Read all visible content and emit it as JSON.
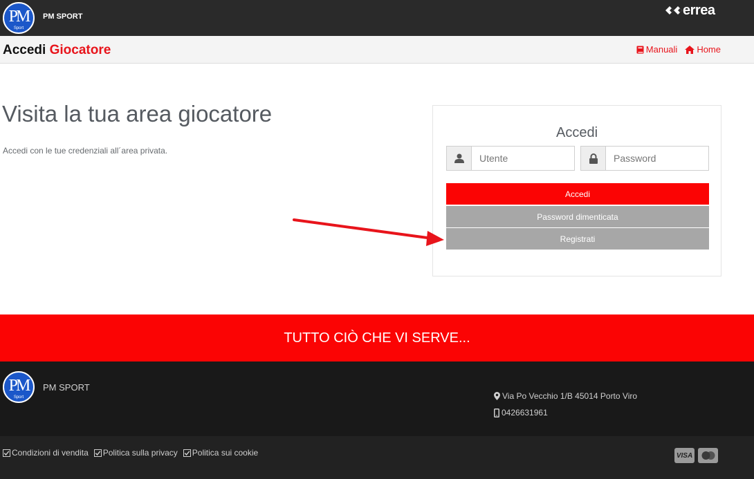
{
  "header": {
    "brand_name": "PM SPORT",
    "logo_monogram": "PM",
    "logo_subtext": "Sport",
    "partner_logo": "errea"
  },
  "subheader": {
    "title_prefix": "Accedi",
    "title_accent": "Giocatore",
    "links": [
      {
        "label": "Manuali",
        "icon": "book-icon"
      },
      {
        "label": "Home",
        "icon": "home-icon"
      }
    ]
  },
  "hero": {
    "title": "Visita la tua area giocatore",
    "text": "Accedi con le tue credenziali all´area privata."
  },
  "login": {
    "title": "Accedi",
    "user_placeholder": "Utente",
    "password_placeholder": "Password",
    "submit_label": "Accedi",
    "forgot_label": "Password dimenticata",
    "register_label": "Registrati"
  },
  "banner": {
    "text": "TUTTO CIÒ CHE VI SERVE..."
  },
  "footer": {
    "brand_name": "PM SPORT",
    "address": "Via Po Vecchio 1/B 45014 Porto Viro",
    "phone": "0426631961"
  },
  "legal": {
    "links": [
      "Condizioni di vendita",
      "Politica sulla privacy",
      "Politica sui cookie"
    ]
  },
  "payments": {
    "visa_label": "VISA"
  },
  "colors": {
    "accent": "#fb0404",
    "title_accent": "#e8141b",
    "dark": "#191919"
  }
}
